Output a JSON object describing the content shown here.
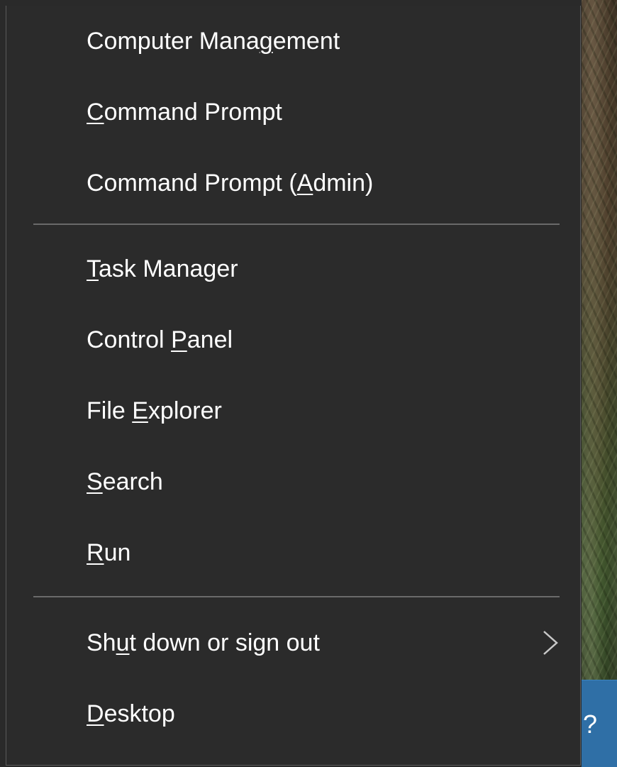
{
  "menu": {
    "items": [
      {
        "pre": "Computer Mana",
        "acc": "g",
        "post": "ement"
      },
      {
        "pre": "",
        "acc": "C",
        "post": "ommand Prompt"
      },
      {
        "pre": "Command Prompt (",
        "acc": "A",
        "post": "dmin)"
      },
      {
        "pre": "",
        "acc": "T",
        "post": "ask Manager"
      },
      {
        "pre": "Control ",
        "acc": "P",
        "post": "anel"
      },
      {
        "pre": "File ",
        "acc": "E",
        "post": "xplorer"
      },
      {
        "pre": "",
        "acc": "S",
        "post": "earch"
      },
      {
        "pre": "",
        "acc": "R",
        "post": "un"
      },
      {
        "pre": "Sh",
        "acc": "u",
        "post": "t down or sign out",
        "submenu_icon": "chevron-right-icon"
      },
      {
        "pre": "",
        "acc": "D",
        "post": "esktop"
      }
    ]
  },
  "taskbar": {
    "visible_glyph": "?"
  },
  "colors": {
    "menu_background": "#2b2b2b",
    "menu_text": "#ffffff",
    "separator": "#6a6a6a",
    "taskbar": "#2f6fa6",
    "chevron": "#c8c8c8"
  }
}
